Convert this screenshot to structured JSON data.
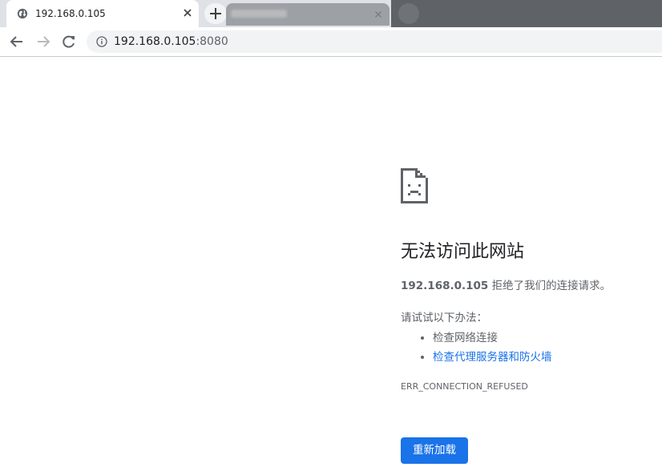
{
  "tabs": {
    "active": {
      "title": "192.168.0.105",
      "favicon": "globe-icon"
    },
    "inactive": {
      "title": ""
    },
    "new_tab_icon": "plus-icon"
  },
  "toolbar": {
    "back_icon": "arrow-left-icon",
    "forward_icon": "arrow-right-icon",
    "reload_icon": "reload-icon",
    "site_info_icon": "info-icon",
    "url_host": "192.168.0.105",
    "url_port": ":8080"
  },
  "error_page": {
    "icon": "sad-page-icon",
    "heading": "无法访问此网站",
    "host": "192.168.0.105",
    "description_suffix": " 拒绝了我们的连接请求。",
    "suggestions_title": "请试试以下办法：",
    "suggestions": [
      "检查网络连接",
      "检查代理服务器和防火墙"
    ],
    "error_code": "ERR_CONNECTION_REFUSED",
    "reload_label": "重新加载"
  },
  "colors": {
    "accent": "#1a73e8",
    "text_secondary": "#5f6368",
    "text_primary": "#202124",
    "tabstrip": "#dee1e6"
  }
}
